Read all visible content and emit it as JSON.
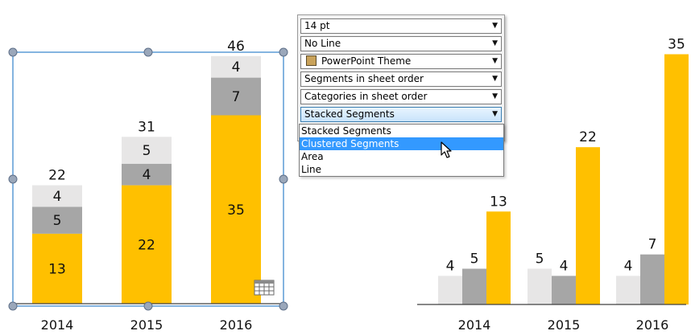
{
  "chart_data": [
    {
      "type": "bar",
      "stacked": true,
      "categories": [
        "2014",
        "2015",
        "2016"
      ],
      "series": [
        {
          "values": [
            13,
            22,
            35
          ],
          "color": "#ffc000"
        },
        {
          "values": [
            5,
            4,
            7
          ],
          "color": "#a6a6a6"
        },
        {
          "values": [
            4,
            5,
            4
          ],
          "color": "#e7e6e6"
        }
      ],
      "totals": [
        "22",
        "31",
        "46"
      ],
      "ylim": [
        0,
        50
      ]
    },
    {
      "type": "bar",
      "stacked": false,
      "categories": [
        "2014",
        "2015",
        "2016"
      ],
      "series": [
        {
          "values": [
            4,
            5,
            4
          ],
          "color": "#e7e6e6"
        },
        {
          "values": [
            5,
            4,
            7
          ],
          "color": "#a6a6a6"
        },
        {
          "values": [
            13,
            22,
            35
          ],
          "color": "#ffc000"
        }
      ],
      "ylim": [
        0,
        38
      ]
    }
  ],
  "panel": {
    "font_size": "14 pt",
    "line": "No Line",
    "theme": "PowerPoint Theme",
    "segment_order": "Segments in sheet order",
    "category_order": "Categories in sheet order",
    "chart_type": "Stacked Segments",
    "options": [
      "Stacked Segments",
      "Clustered Segments",
      "Area",
      "Line"
    ],
    "highlighted_index": 1
  },
  "colors": {
    "accent": "#ffc000",
    "selection": "#5b9bd5",
    "highlight": "#3399ff"
  }
}
